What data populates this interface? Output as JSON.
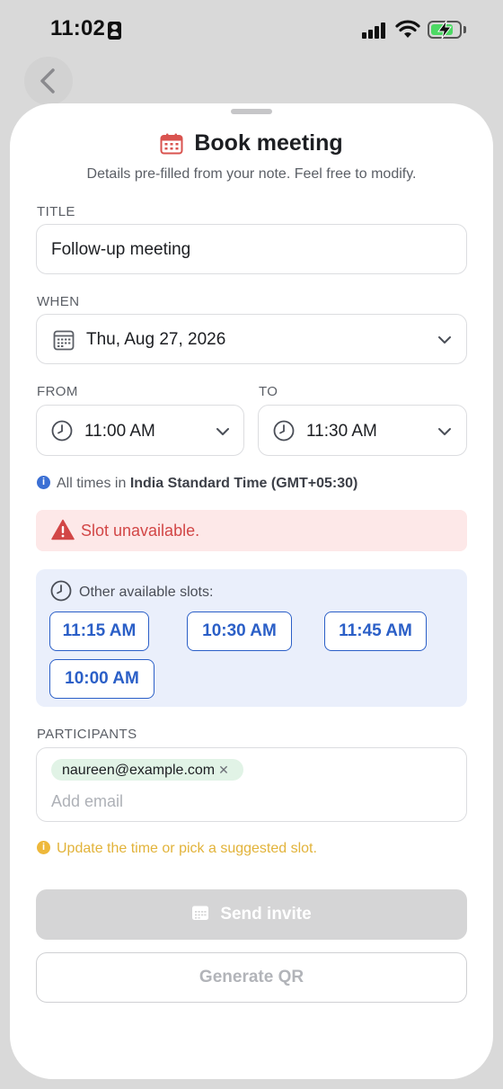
{
  "status_bar": {
    "time": "11:02"
  },
  "sheet": {
    "title": "Book meeting",
    "subtitle": "Details pre-filled from your note. Feel free to modify."
  },
  "form": {
    "title_label": "TITLE",
    "title_value": "Follow-up meeting",
    "when_label": "WHEN",
    "date_value": "Thu, Aug 27, 2026",
    "from_label": "FROM",
    "from_value": "11:00 AM",
    "to_label": "TO",
    "to_value": "11:30 AM",
    "timezone_prefix": "All times in",
    "timezone_name": "India Standard Time (GMT+05:30)"
  },
  "alert": {
    "text": "Slot unavailable."
  },
  "slots": {
    "label": "Other available slots:",
    "items": [
      "11:15 AM",
      "10:30 AM",
      "11:45 AM",
      "10:00 AM"
    ]
  },
  "participants": {
    "label": "PARTICIPANTS",
    "chips": [
      "naureen@example.com"
    ],
    "placeholder": "Add email"
  },
  "warning": {
    "text": "Update the time or pick a suggested slot."
  },
  "actions": {
    "send_label": "Send invite",
    "qr_label": "Generate QR"
  },
  "colors": {
    "accent": "#2b5fc7",
    "alert_bg": "#fde8e8",
    "alert_text": "#d24646",
    "slots_bg": "#eaeffb",
    "chip_bg": "#e1f3e6",
    "warning": "#e2b33a",
    "disabled_button": "#d5d5d6"
  }
}
